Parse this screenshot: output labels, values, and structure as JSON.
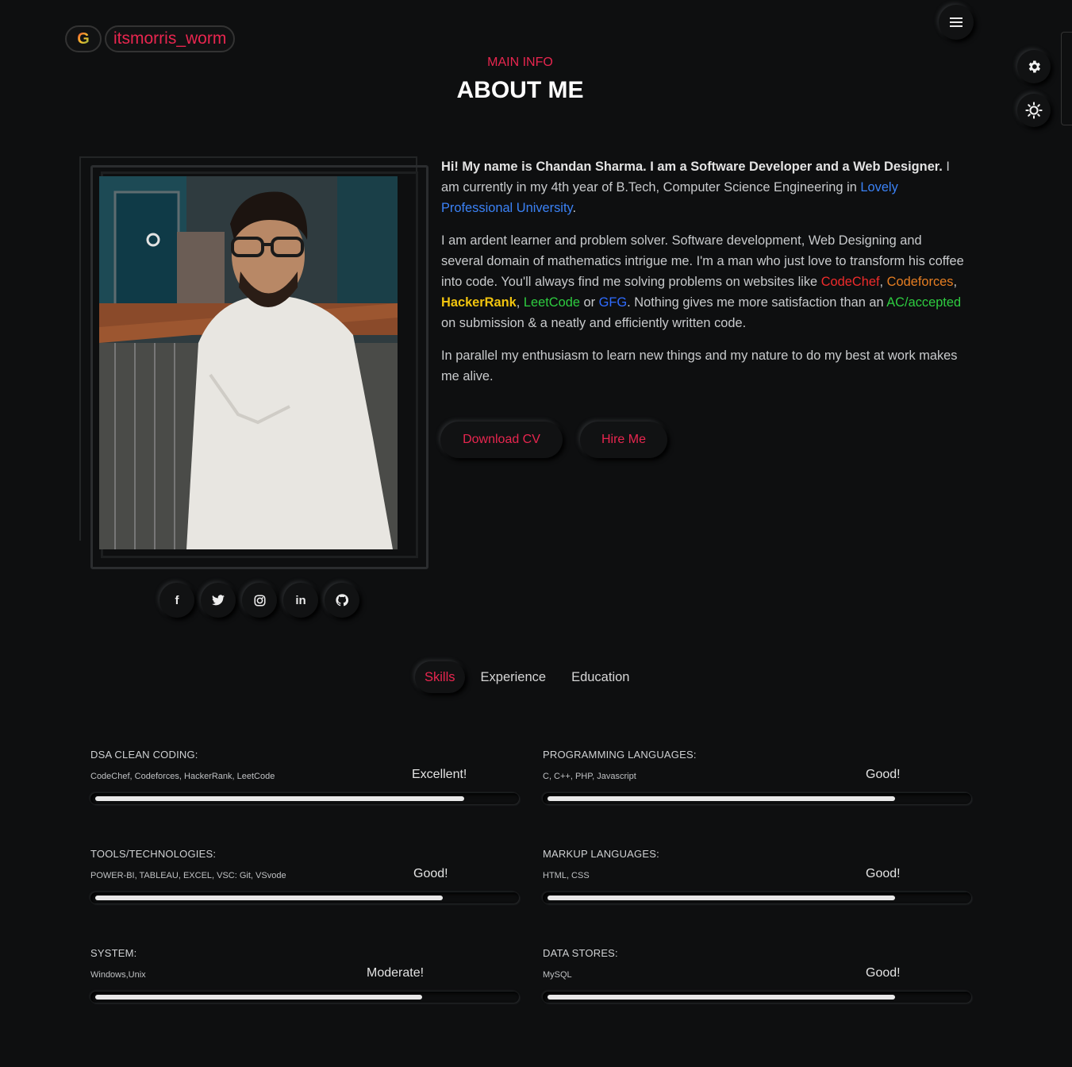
{
  "header": {
    "logo_letter": "G",
    "username": "itsmorris_worm",
    "menu_icon": "hamburger-icon",
    "settings_icon": "gear-icon",
    "theme_icon": "sun-icon"
  },
  "section": {
    "subtitle": "MAIN INFO",
    "title": "ABOUT ME"
  },
  "about": {
    "intro_bold": "Hi! My name is Chandan Sharma. I am a Software Developer and a Web Designer.",
    "intro_rest": " I am currently in my 4th year of B.Tech, Computer Science Engineering in ",
    "university": "Lovely Professional University",
    "intro_end": ".",
    "p2_a": "I am ardent learner and problem solver. Software development, Web Designing and several domain of mathematics intrigue me. I'm a man who just love to transform his coffee into code. You'll always find me solving problems on websites like ",
    "codechef": "CodeChef",
    "comma1": ", ",
    "codeforces": "Codeforces",
    "comma2": ", ",
    "hackerrank": "HackerRank",
    "comma3": ", ",
    "leetcode": "LeetCode",
    "or": " or ",
    "gfg": "GFG",
    "p2_b": ". Nothing gives me more satisfaction than an ",
    "ac": "AC/accepted",
    "p2_c": " on submission & a neatly and efficiently written code.",
    "p3": "In parallel my enthusiasm to learn new things and my nature to do my best at work makes me alive."
  },
  "buttons": {
    "download_cv": "Download CV",
    "hire_me": "Hire Me"
  },
  "social": [
    {
      "icon": "facebook-icon",
      "glyph": "f"
    },
    {
      "icon": "twitter-icon",
      "glyph": "🐦"
    },
    {
      "icon": "instagram-icon",
      "glyph": "◎"
    },
    {
      "icon": "linkedin-icon",
      "glyph": "in"
    },
    {
      "icon": "github-icon",
      "glyph": "◉"
    }
  ],
  "tabs": [
    "Skills",
    "Experience",
    "Education"
  ],
  "skills": [
    {
      "title": "DSA CLEAN CODING:",
      "sub": "CodeChef, Codeforces, HackerRank, LeetCode",
      "level": "Excellent!",
      "value": 0.88
    },
    {
      "title": "PROGRAMMING LANGUAGES:",
      "sub": "C, C++, PHP, Javascript",
      "level": "Good!",
      "value": 0.83
    },
    {
      "title": "TOOLS/TECHNOLOGIES:",
      "sub": "POWER-BI, TABLEAU, EXCEL, VSC: Git, VSvode",
      "level": "Good!",
      "value": 0.83
    },
    {
      "title": "MARKUP LANGUAGES:",
      "sub": "HTML, CSS",
      "level": "Good!",
      "value": 0.83
    },
    {
      "title": "SYSTEM:",
      "sub": "Windows,Unix",
      "level": "Moderate!",
      "value": 0.78
    },
    {
      "title": "DATA STORES:",
      "sub": "MySQL",
      "level": "Good!",
      "value": 0.83
    }
  ],
  "colors": {
    "accent": "#e8264f",
    "background": "#0e0f10"
  }
}
